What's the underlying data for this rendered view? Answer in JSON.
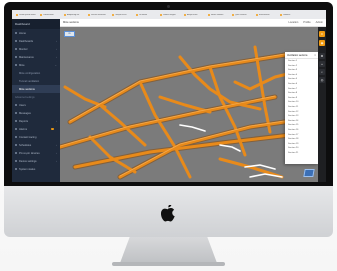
{
  "browser": {
    "bookmarks": [
      {
        "label": "Lorem ipsum dolor"
      },
      {
        "label": "Consectetur"
      },
      {
        "label": "Adipiscing elit"
      },
      {
        "label": "Sed do eiusmod"
      },
      {
        "label": "Tempor incid"
      },
      {
        "label": "Ut labore"
      },
      {
        "label": "Dolore magna"
      },
      {
        "label": "Aliqua enim"
      },
      {
        "label": "Minim veniam"
      },
      {
        "label": "Quis nostrud"
      },
      {
        "label": "Exercitation"
      },
      {
        "label": "Ullamco"
      }
    ]
  },
  "sidebar": {
    "brand": "Dashboard",
    "items": [
      {
        "label": "Home"
      },
      {
        "label": "Dashboards"
      },
      {
        "label": "Monitor"
      },
      {
        "label": "Maintenance"
      },
      {
        "label": "Mine"
      },
      {
        "label": "Mine configuration"
      },
      {
        "label": "Tunnel ventilation"
      },
      {
        "label": "Mine sections"
      },
      {
        "label": "Advanced settings"
      },
      {
        "label": "Users"
      },
      {
        "label": "Messages"
      },
      {
        "label": "Reports"
      },
      {
        "label": "Alarms"
      },
      {
        "label": "Contact tracing"
      },
      {
        "label": "Schedules"
      },
      {
        "label": "Pin-to-pin devices"
      },
      {
        "label": "Device settings"
      },
      {
        "label": "System status"
      }
    ]
  },
  "topbar": {
    "title": "Mine sections",
    "right": [
      "Location",
      "Profile",
      "Admin"
    ]
  },
  "viewport": {
    "tag": "2D"
  },
  "list_panel": {
    "title": "Ventilation sections",
    "rows": [
      "Section 1",
      "Section 2",
      "Section 3",
      "Section 4",
      "Section 5",
      "Section 6",
      "Section 7",
      "Section 8",
      "Section 9",
      "Section 10",
      "Section 11",
      "Section 12",
      "Section 13",
      "Section 14",
      "Section 15",
      "Section 16",
      "Section 17",
      "Section 18",
      "Section 19",
      "Section 20",
      "Section 21"
    ]
  },
  "rail": {
    "buttons": [
      {
        "icon": "layers-icon"
      },
      {
        "icon": "camera-icon"
      },
      {
        "icon": "settings-icon"
      },
      {
        "icon": "crosshair-icon"
      },
      {
        "icon": "search-icon"
      },
      {
        "icon": "eye-icon"
      }
    ]
  },
  "colors": {
    "tunnel": "#e88a1a",
    "tunnel_highlight": "#ffffff",
    "sidebar": "#1f2a3c",
    "viewport_bg": "#7b7b7b",
    "accent": "#f39c12"
  }
}
